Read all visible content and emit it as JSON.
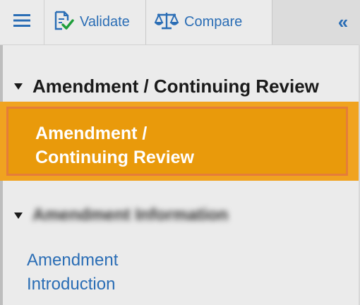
{
  "toolbar": {
    "menu_icon": "hamburger-menu-icon",
    "validate_label": "Validate",
    "validate_icon": "document-check-icon",
    "compare_label": "Compare",
    "compare_icon": "balance-scale-icon",
    "collapse_glyph": "«",
    "collapse_icon": "double-chevron-left-icon"
  },
  "navigation": {
    "section_title": "Amendment / Continuing Review",
    "selected_item_line1": "Amendment /",
    "selected_item_line2": "Continuing Review",
    "subsection_title": "Amendment Information",
    "link_line1": "Amendment",
    "link_line2": "Introduction"
  },
  "colors": {
    "accent_blue": "#2a6db5",
    "selected_bg": "#e99a0b",
    "selected_border": "#e57d3a",
    "panel_bg": "#ebebeb"
  }
}
